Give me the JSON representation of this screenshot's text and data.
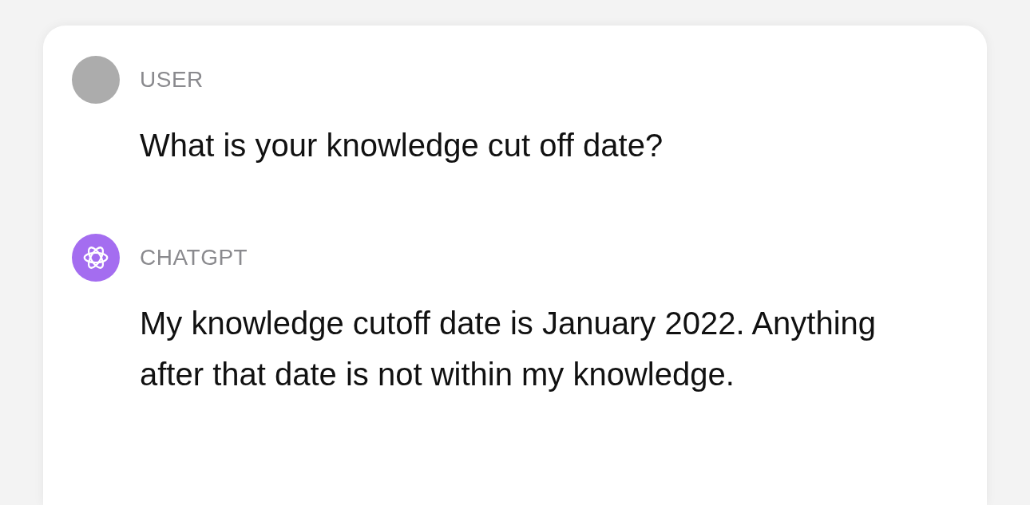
{
  "messages": [
    {
      "kind": "user",
      "color": "#acacac",
      "author": "USER",
      "text": "What is your knowledge cut off date?"
    },
    {
      "kind": "assistant",
      "color": "#a46df0",
      "author": "CHATGPT",
      "text": "My knowledge cutoff date is January 2022. Anything after that date is not within my knowledge."
    }
  ]
}
